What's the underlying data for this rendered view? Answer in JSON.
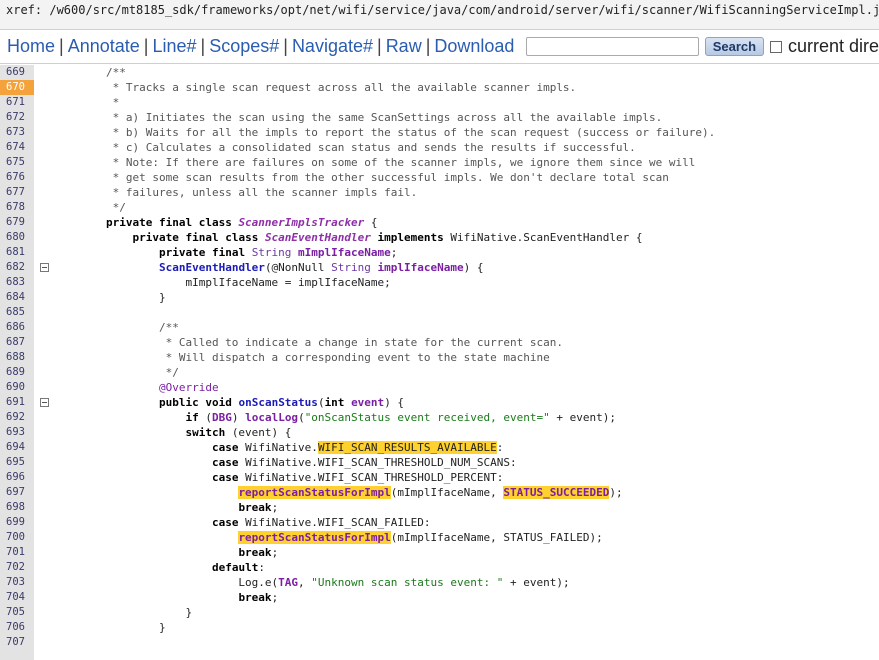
{
  "xref": {
    "path": "xref: /w600/src/mt8185_sdk/frameworks/opt/net/wifi/service/java/com/android/server/wifi/scanner/WifiScanningServiceImpl.java"
  },
  "nav": {
    "links": [
      "Home",
      "Annotate",
      "Line#",
      "Scopes#",
      "Navigate#",
      "Raw",
      "Download"
    ],
    "separator": "|",
    "search_value": "",
    "search_button": "Search",
    "current_dir_label": "current dire"
  },
  "code": {
    "highlight_line": "670",
    "lines": [
      {
        "n": "669",
        "fold": false,
        "parts": [
          [
            "        ",
            ""
          ],
          [
            "/**",
            "c"
          ]
        ]
      },
      {
        "n": "670",
        "fold": false,
        "parts": [
          [
            "         * Tracks a single scan request across all the available scanner impls.",
            "c"
          ]
        ]
      },
      {
        "n": "671",
        "fold": false,
        "parts": [
          [
            "         *",
            "c"
          ]
        ]
      },
      {
        "n": "672",
        "fold": false,
        "parts": [
          [
            "         * a) Initiates the scan using the same ScanSettings across all the available impls.",
            "c"
          ]
        ]
      },
      {
        "n": "673",
        "fold": false,
        "parts": [
          [
            "         * b) Waits for all the impls to report the status of the scan request (success or failure).",
            "c"
          ]
        ]
      },
      {
        "n": "674",
        "fold": false,
        "parts": [
          [
            "         * c) Calculates a consolidated scan status and sends the results if successful.",
            "c"
          ]
        ]
      },
      {
        "n": "675",
        "fold": false,
        "parts": [
          [
            "         * Note: If there are failures on some of the scanner impls, we ignore them since we will",
            "c"
          ]
        ]
      },
      {
        "n": "676",
        "fold": false,
        "parts": [
          [
            "         * get some scan results from the other successful impls. We don't declare total scan",
            "c"
          ]
        ]
      },
      {
        "n": "677",
        "fold": false,
        "parts": [
          [
            "         * failures, unless all the scanner impls fail.",
            "c"
          ]
        ]
      },
      {
        "n": "678",
        "fold": false,
        "parts": [
          [
            "         */",
            "c"
          ]
        ]
      },
      {
        "n": "679",
        "fold": false,
        "parts": [
          [
            "        ",
            ""
          ],
          [
            "private final class ",
            "k"
          ],
          [
            "ScannerImplsTracker",
            "t"
          ],
          [
            " {",
            ""
          ]
        ]
      },
      {
        "n": "680",
        "fold": false,
        "parts": [
          [
            "            ",
            ""
          ],
          [
            "private final class ",
            "k"
          ],
          [
            "ScanEventHandler",
            "t"
          ],
          [
            " ",
            ""
          ],
          [
            "implements ",
            "k"
          ],
          [
            "WifiNative.ScanEventHandler {",
            ""
          ]
        ]
      },
      {
        "n": "681",
        "fold": false,
        "parts": [
          [
            "                ",
            ""
          ],
          [
            "private final ",
            "k"
          ],
          [
            "String ",
            "ty"
          ],
          [
            "mImplIfaceName",
            "f"
          ],
          [
            ";",
            ""
          ]
        ]
      },
      {
        "n": "682",
        "fold": true,
        "parts": [
          [
            "                ",
            ""
          ],
          [
            "ScanEventHandler",
            "m"
          ],
          [
            "(@NonNull ",
            ""
          ],
          [
            "String ",
            "ty"
          ],
          [
            "implIfaceName",
            "f"
          ],
          [
            ") {",
            ""
          ]
        ]
      },
      {
        "n": "683",
        "fold": false,
        "parts": [
          [
            "                    mImplIfaceName = implIfaceName;",
            ""
          ]
        ]
      },
      {
        "n": "684",
        "fold": false,
        "parts": [
          [
            "                }",
            ""
          ]
        ]
      },
      {
        "n": "685",
        "fold": false,
        "parts": [
          [
            "",
            ""
          ]
        ]
      },
      {
        "n": "686",
        "fold": false,
        "parts": [
          [
            "                ",
            ""
          ],
          [
            "/**",
            "c"
          ]
        ]
      },
      {
        "n": "687",
        "fold": false,
        "parts": [
          [
            "                 * Called to indicate a change in state for the current scan.",
            "c"
          ]
        ]
      },
      {
        "n": "688",
        "fold": false,
        "parts": [
          [
            "                 * Will dispatch a corresponding event to the state machine",
            "c"
          ]
        ]
      },
      {
        "n": "689",
        "fold": false,
        "parts": [
          [
            "                 */",
            "c"
          ]
        ]
      },
      {
        "n": "690",
        "fold": false,
        "parts": [
          [
            "                ",
            ""
          ],
          [
            "@Override",
            "an"
          ]
        ]
      },
      {
        "n": "691",
        "fold": true,
        "parts": [
          [
            "                ",
            ""
          ],
          [
            "public void ",
            "k"
          ],
          [
            "onScanStatus",
            "m"
          ],
          [
            "(",
            ""
          ],
          [
            "int ",
            "k"
          ],
          [
            "event",
            "f"
          ],
          [
            ") {",
            ""
          ]
        ]
      },
      {
        "n": "692",
        "fold": false,
        "parts": [
          [
            "                    ",
            ""
          ],
          [
            "if ",
            "k"
          ],
          [
            "(",
            ""
          ],
          [
            "DBG",
            "f"
          ],
          [
            ") ",
            ""
          ],
          [
            "localLog",
            "f"
          ],
          [
            "(",
            ""
          ],
          [
            "\"onScanStatus event received, event=\"",
            "s"
          ],
          [
            " + event);",
            ""
          ]
        ]
      },
      {
        "n": "693",
        "fold": false,
        "parts": [
          [
            "                    ",
            ""
          ],
          [
            "switch ",
            "k"
          ],
          [
            "(event) {",
            ""
          ]
        ]
      },
      {
        "n": "694",
        "fold": false,
        "parts": [
          [
            "                        ",
            ""
          ],
          [
            "case ",
            "k"
          ],
          [
            "WifiNative.",
            ""
          ],
          [
            "WIFI_SCAN_RESULTS_AVAILABLE",
            "h"
          ],
          [
            ":",
            ""
          ]
        ]
      },
      {
        "n": "695",
        "fold": false,
        "parts": [
          [
            "                        ",
            ""
          ],
          [
            "case ",
            "k"
          ],
          [
            "WifiNative.WIFI_SCAN_THRESHOLD_NUM_SCANS:",
            ""
          ]
        ]
      },
      {
        "n": "696",
        "fold": false,
        "parts": [
          [
            "                        ",
            ""
          ],
          [
            "case ",
            "k"
          ],
          [
            "WifiNative.WIFI_SCAN_THRESHOLD_PERCENT:",
            ""
          ]
        ]
      },
      {
        "n": "697",
        "fold": false,
        "parts": [
          [
            "                            ",
            ""
          ],
          [
            "reportScanStatusForImpl",
            "h f"
          ],
          [
            "(mImplIfaceName, ",
            ""
          ],
          [
            "STATUS_SUCCEEDED",
            "h f"
          ],
          [
            ");",
            ""
          ]
        ]
      },
      {
        "n": "698",
        "fold": false,
        "parts": [
          [
            "                            ",
            ""
          ],
          [
            "break",
            "k"
          ],
          [
            ";",
            ""
          ]
        ]
      },
      {
        "n": "699",
        "fold": false,
        "parts": [
          [
            "                        ",
            ""
          ],
          [
            "case ",
            "k"
          ],
          [
            "WifiNative.WIFI_SCAN_FAILED:",
            ""
          ]
        ]
      },
      {
        "n": "700",
        "fold": false,
        "parts": [
          [
            "                            ",
            ""
          ],
          [
            "reportScanStatusForImpl",
            "h f"
          ],
          [
            "(mImplIfaceName, STATUS_FAILED);",
            ""
          ]
        ]
      },
      {
        "n": "701",
        "fold": false,
        "parts": [
          [
            "                            ",
            ""
          ],
          [
            "break",
            "k"
          ],
          [
            ";",
            ""
          ]
        ]
      },
      {
        "n": "702",
        "fold": false,
        "parts": [
          [
            "                        ",
            ""
          ],
          [
            "default",
            "k"
          ],
          [
            ":",
            ""
          ]
        ]
      },
      {
        "n": "703",
        "fold": false,
        "parts": [
          [
            "                            Log.e(",
            ""
          ],
          [
            "TAG",
            "f"
          ],
          [
            ", ",
            ""
          ],
          [
            "\"Unknown scan status event: \"",
            "s"
          ],
          [
            " + event);",
            ""
          ]
        ]
      },
      {
        "n": "704",
        "fold": false,
        "parts": [
          [
            "                            ",
            ""
          ],
          [
            "break",
            "k"
          ],
          [
            ";",
            ""
          ]
        ]
      },
      {
        "n": "705",
        "fold": false,
        "parts": [
          [
            "                    }",
            ""
          ]
        ]
      },
      {
        "n": "706",
        "fold": false,
        "parts": [
          [
            "                }",
            ""
          ]
        ]
      },
      {
        "n": "707",
        "fold": false,
        "parts": [
          [
            "",
            ""
          ]
        ]
      }
    ]
  }
}
